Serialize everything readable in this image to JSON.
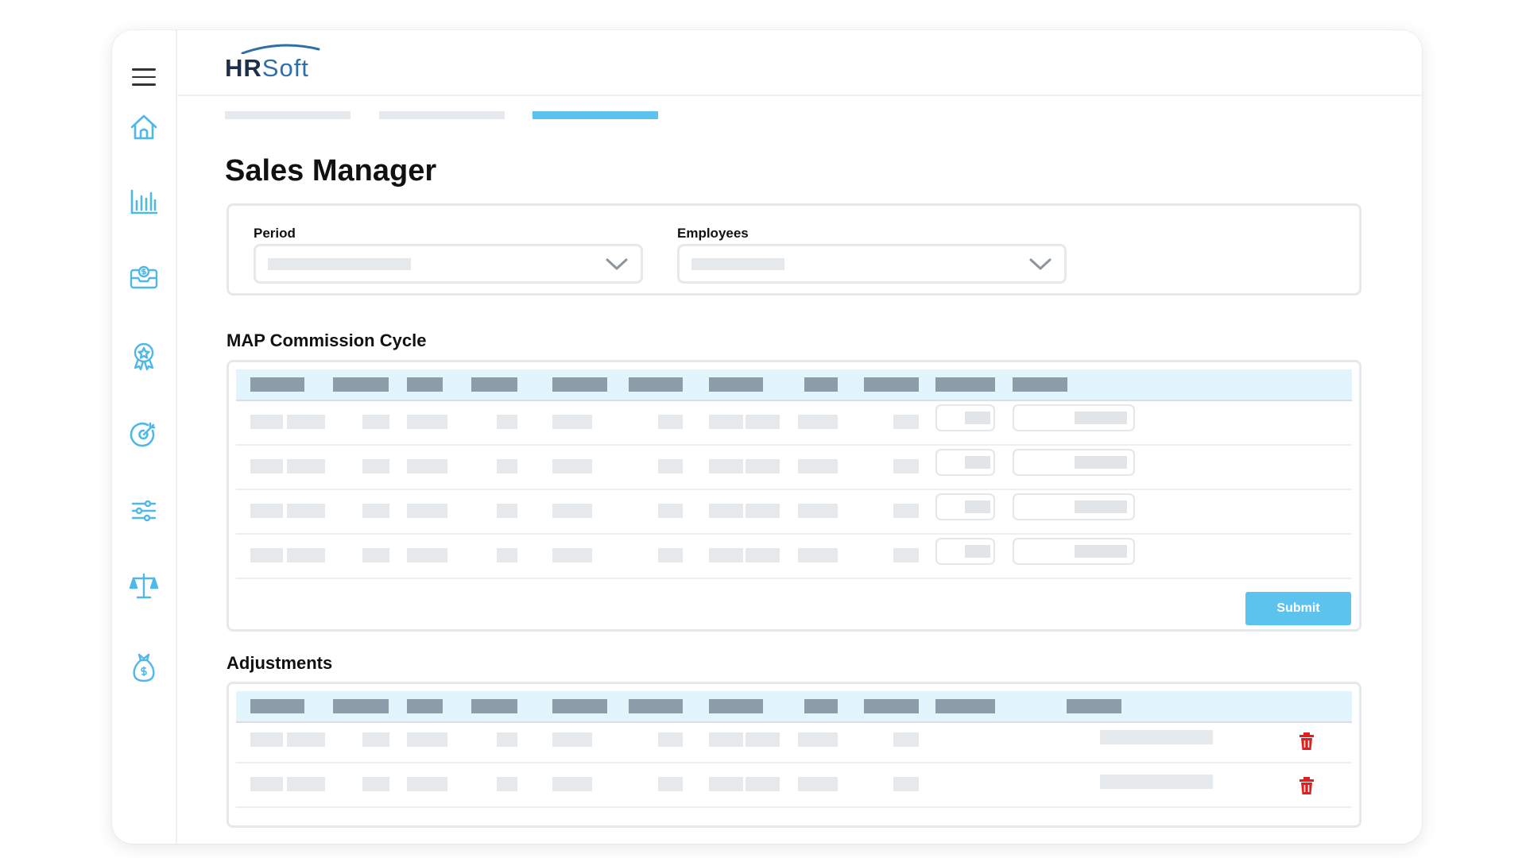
{
  "app": {
    "logo_bold": "HR",
    "logo_light": "Soft"
  },
  "sidebar": {
    "items": [
      {
        "icon": "home-icon"
      },
      {
        "icon": "bar-chart-icon"
      },
      {
        "icon": "money-inbox-icon"
      },
      {
        "icon": "award-badge-icon"
      },
      {
        "icon": "target-icon"
      },
      {
        "icon": "sliders-icon"
      },
      {
        "icon": "scales-icon"
      },
      {
        "icon": "money-bag-icon"
      }
    ]
  },
  "steps": {
    "count": 3,
    "active_index": 2
  },
  "page": {
    "title": "Sales Manager"
  },
  "filters": {
    "period_label": "Period",
    "employees_label": "Employees"
  },
  "commission": {
    "title": "MAP Commission Cycle",
    "submit_label": "Submit",
    "row_count": 4
  },
  "adjustments": {
    "title": "Adjustments",
    "row_count": 2
  },
  "colors": {
    "accent": "#5cc3ef",
    "header_bg": "#e2f4fc",
    "delete": "#e02020",
    "logo_dark": "#1d3048",
    "logo_blue": "#2f6fa8"
  }
}
